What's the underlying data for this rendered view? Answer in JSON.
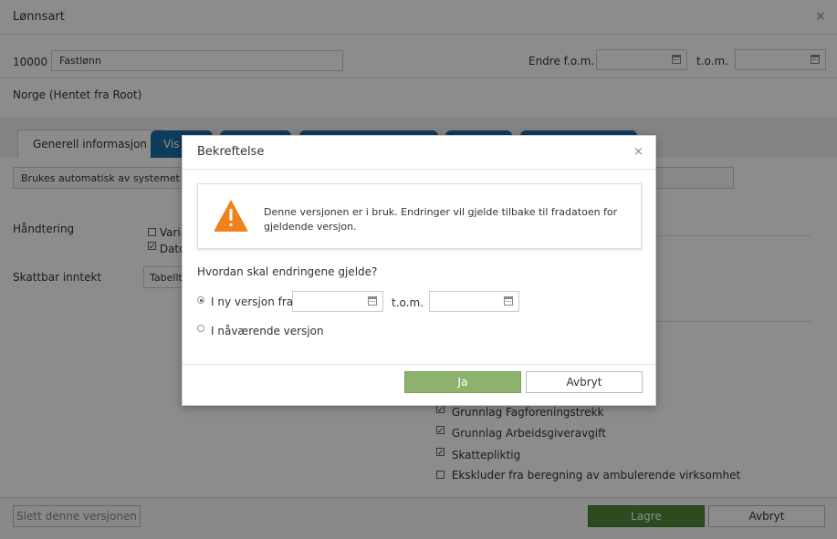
{
  "window": {
    "title": "Lønnsart",
    "close_glyph": "×"
  },
  "header_row": {
    "code_label": "10000 -",
    "name_value": "Fastlønn",
    "change_from_label": "Endre f.o.m.",
    "to_label": "t.o.m."
  },
  "country_text": "Norge (Hentet fra Root)",
  "tabs": [
    {
      "label": "Generell informasjon"
    },
    {
      "label": "Vis"
    }
  ],
  "description_value": "Brukes automatisk av systemet nå",
  "handling": {
    "label": "Håndtering",
    "options": [
      {
        "label": "Varia",
        "checked": false
      },
      {
        "label": "Dato",
        "checked": true
      }
    ]
  },
  "taxable_income": {
    "label": "Skattbar inntekt",
    "select_value": "Tabellt"
  },
  "checkbox_list": [
    {
      "label": "Grunnlag Fagforeningstrekk",
      "checked": true
    },
    {
      "label": "Grunnlag Arbeidsgiveravgift",
      "checked": true
    },
    {
      "label": "Skattepliktig",
      "checked": true
    },
    {
      "label": "Ekskluder fra beregning av ambulerende virksomhet",
      "checked": false
    }
  ],
  "footer": {
    "delete_label": "Slett denne versjonen",
    "save_label": "Lagre",
    "cancel_label": "Avbryt"
  },
  "dialog": {
    "title": "Bekreftelse",
    "close_glyph": "×",
    "warning_icon": "warning-triangle-icon",
    "warning_color": "#f0821e",
    "warning_text": "Denne versjonen er i bruk. Endringer vil gjelde tilbake til fradatoen for gjeldende versjon.",
    "question": "Hvordan skal endringene gjelde?",
    "option_new_version": "I ny versjon fra",
    "option_to_label": "t.o.m.",
    "option_current_version": "I nåværende versjon",
    "selected_option": "new_version",
    "yes_label": "Ja",
    "cancel_label": "Avbryt"
  },
  "colors": {
    "tab_blue": "#1b6fa8",
    "save_green": "#4d8a3a",
    "ja_green": "#8db26e"
  }
}
